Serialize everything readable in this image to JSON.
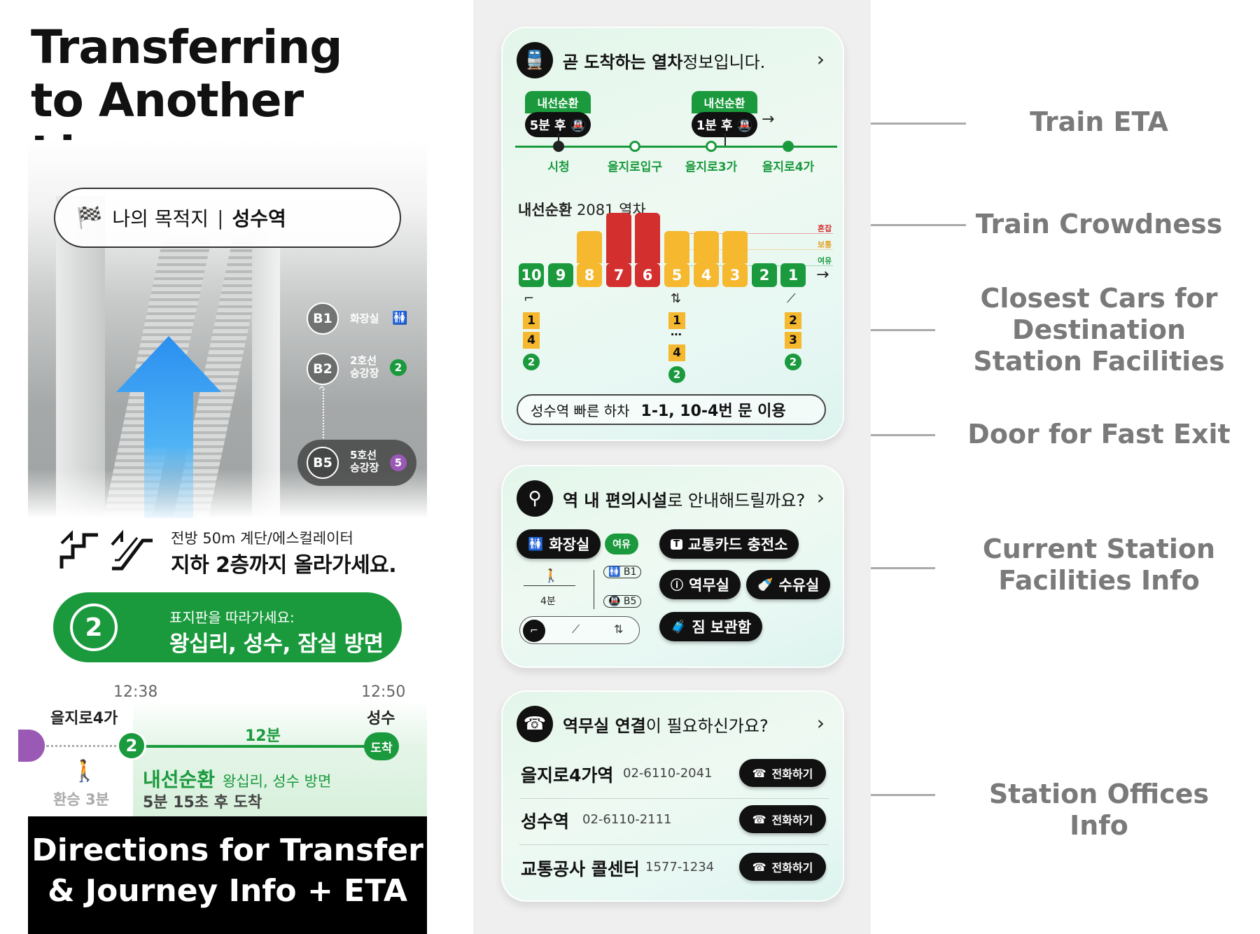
{
  "left": {
    "title_line1": "Transferring",
    "title_line2": "to Another Line",
    "destination": {
      "label": "나의 목적지",
      "separator": "|",
      "station": "성수역"
    },
    "floors": [
      {
        "level": "B1",
        "label1": "화장실",
        "label2": "",
        "badge": "",
        "icon": "restroom-icon"
      },
      {
        "level": "B2",
        "label1": "2호선",
        "label2": "승강장",
        "badge": "2",
        "color": "#1a9a3d"
      },
      {
        "level": "B5",
        "label1": "5호선",
        "label2": "승강장",
        "badge": "5",
        "color": "#9b59b6"
      }
    ],
    "step": {
      "sub": "전방 50m 계단/에스컬레이터",
      "main": "지하 2층까지 올라가세요."
    },
    "sign": {
      "line": "2",
      "sub": "표지판을 따라가세요:",
      "main": "왕십리, 성수, 잠실 방면"
    },
    "journey": {
      "start_time": "12:38",
      "end_time": "12:50",
      "start_station": "을지로4가",
      "end_station": "성수",
      "line_number": "2",
      "duration": "12분",
      "arrive_label": "도착",
      "transfer": "환승 3분",
      "line_name": "내선순환",
      "direction": "왕십리, 성수 방면",
      "eta": "5분 15초 후 도착"
    },
    "caption_line1": "Directions for Transfer",
    "caption_line2": "& Journey Info + ETA"
  },
  "eta_card": {
    "head_bold": "곧 도착하는 열차",
    "head_rest": " 정보입니다.",
    "chevron": "›",
    "trains": [
      {
        "line": "내선순환",
        "time": "5분 후"
      },
      {
        "line": "내선순환",
        "time": "1분 후"
      }
    ],
    "arrow": "→",
    "stations": [
      "시청",
      "을지로입구",
      "을지로3가",
      "을지로4가"
    ],
    "train_line": "내선순환",
    "train_no": "2081 열차",
    "levels": [
      {
        "label": "혼잡",
        "color": "#d32f2f"
      },
      {
        "label": "보통",
        "color": "#f5b82e"
      },
      {
        "label": "여유",
        "color": "#1a9a3d"
      }
    ],
    "cars": [
      {
        "num": "10",
        "level": "여유",
        "load": 0
      },
      {
        "num": "9",
        "level": "여유",
        "load": 0
      },
      {
        "num": "8",
        "level": "보통",
        "load": 1
      },
      {
        "num": "7",
        "level": "혼잡",
        "load": 2
      },
      {
        "num": "6",
        "level": "혼잡",
        "load": 2
      },
      {
        "num": "5",
        "level": "보통",
        "load": 1
      },
      {
        "num": "4",
        "level": "보통",
        "load": 1
      },
      {
        "num": "3",
        "level": "보통",
        "load": 1
      },
      {
        "num": "2",
        "level": "여유",
        "load": 0
      },
      {
        "num": "1",
        "level": "여유",
        "load": 0
      }
    ],
    "closest": [
      {
        "icon": "stairs-icon",
        "doors": [
          "1",
          "4"
        ],
        "dots": "",
        "exit": "2"
      },
      {
        "icon": "elevator-icon",
        "doors": [
          "1",
          "4"
        ],
        "dots": "⋯",
        "exit": "2"
      },
      {
        "icon": "escalator-icon",
        "doors": [
          "2",
          "3"
        ],
        "dots": "",
        "exit": "2"
      }
    ],
    "fast_exit_label": "성수역 빠른 하차",
    "fast_exit_value": "1-1, 10-4번 문 이용"
  },
  "facility_card": {
    "head_bold": "역 내 편의시설",
    "head_rest": "로 안내해드릴까요?",
    "chevron": "›",
    "restroom": "화장실",
    "restroom_status": "여유",
    "walk_time": "4분",
    "floor_b1": "B1",
    "floor_b5": "B5",
    "buttons": [
      "교통카드 충전소",
      "역무실",
      "수유실",
      "짐 보관함"
    ]
  },
  "office_card": {
    "head_bold": "역무실 연결",
    "head_rest": "이 필요하신가요?",
    "chevron": "›",
    "call_label": "전화하기",
    "offices": [
      {
        "name": "을지로4가역",
        "phone": "02-6110-2041"
      },
      {
        "name": "성수역",
        "phone": "02-6110-2111"
      },
      {
        "name": "교통공사 콜센터",
        "phone": "1577-1234"
      }
    ]
  },
  "features": [
    "Train ETA",
    "Train Crowdness",
    "Closest Cars for Destination Station Facilities",
    "Door for Fast Exit",
    "Current Station Facilities Info",
    "Station Offices Info"
  ]
}
